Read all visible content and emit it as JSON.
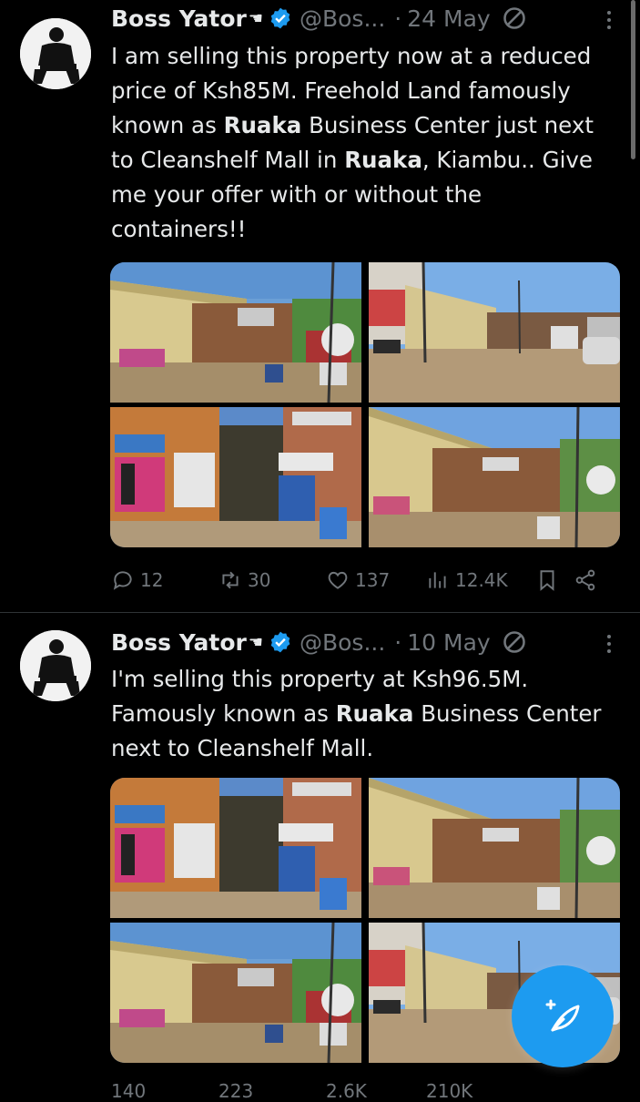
{
  "tweets": [
    {
      "author_name": "Boss Yator",
      "author_emoji": "☚",
      "handle": "@Bos...",
      "date": "24 May",
      "text_parts": [
        "I am selling this property now at a reduced price of Ksh85M. Freehold Land famously known as ",
        "Ruaka",
        " Business Center just next to Cleanshelf Mall in ",
        "Ruaka",
        ", Kiambu.. Give me your offer with or without the containers!!"
      ],
      "replies": "12",
      "retweets": "30",
      "likes": "137",
      "views": "12.4K",
      "images": [
        "street-scene-1",
        "street-scene-2",
        "storefront-closeup",
        "street-scene-wide"
      ]
    },
    {
      "author_name": "Boss Yator",
      "author_emoji": "☚",
      "handle": "@Bos...",
      "date": "10 May",
      "text_parts": [
        "I'm selling this property at Ksh96.5M. Famously known as ",
        "Ruaka",
        " Business Center next to Cleanshelf Mall."
      ],
      "replies": "140",
      "retweets": "223",
      "likes": "2.6K",
      "views": "210K",
      "images": [
        "storefront-closeup",
        "street-scene-wide",
        "street-scene-1",
        "street-scene-2"
      ]
    }
  ],
  "colors": {
    "background": "#000000",
    "text": "#e7e9ea",
    "muted": "#71767b",
    "accent": "#1d9bf0"
  }
}
